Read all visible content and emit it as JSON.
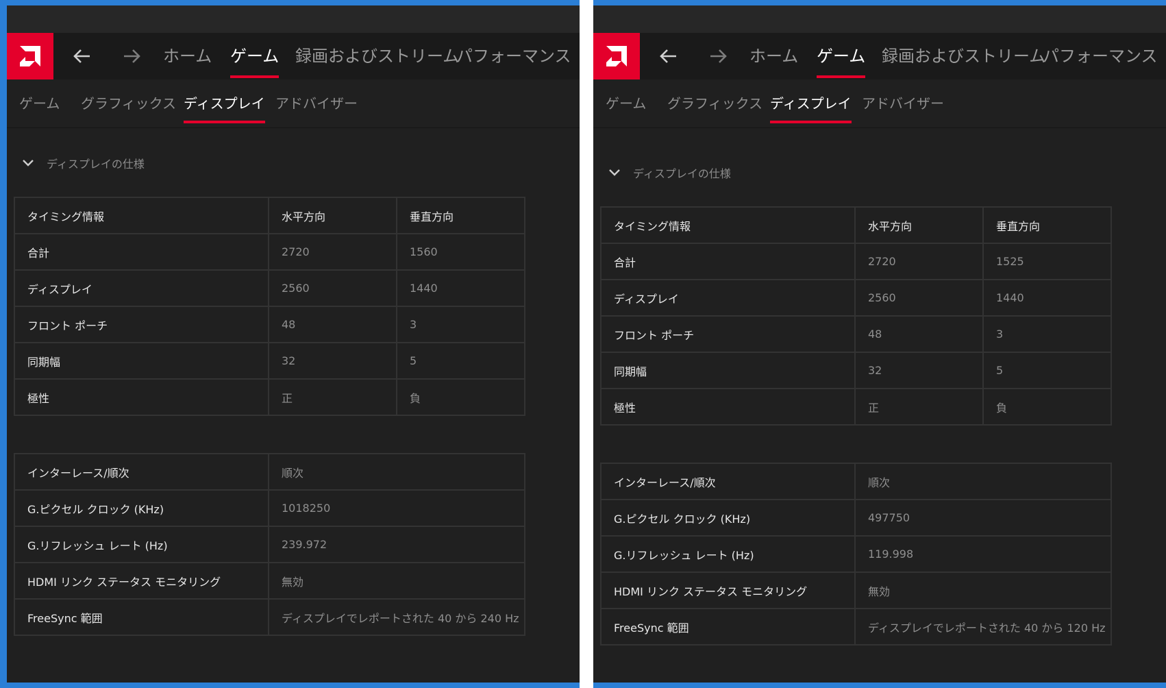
{
  "nav": {
    "home": "ホーム",
    "game": "ゲーム",
    "record": "録画およびストリーム",
    "performance": "パフォーマンス"
  },
  "subnav": {
    "game": "ゲーム",
    "graphics": "グラフィックス",
    "display": "ディスプレイ",
    "advisor": "アドバイザー"
  },
  "section_title": "ディスプレイの仕様",
  "columns": {
    "timing": "タイミング情報",
    "horizontal": "水平方向",
    "vertical": "垂直方向"
  },
  "labels": {
    "total": "合計",
    "display": "ディスプレイ",
    "front_porch": "フロント ポーチ",
    "sync_width": "同期幅",
    "polarity": "極性",
    "interlace": "インターレース/順次",
    "pixel_clock": "G.ピクセル クロック (KHz)",
    "refresh_rate": "G.リフレッシュ レート (Hz)",
    "hdmi_monitoring": "HDMI リンク ステータス モニタリング",
    "freesync": "FreeSync 範囲"
  },
  "left": {
    "total_h": "2720",
    "total_v": "1560",
    "display_h": "2560",
    "display_v": "1440",
    "porch_h": "48",
    "porch_v": "3",
    "sync_h": "32",
    "sync_v": "5",
    "polarity_h": "正",
    "polarity_v": "負",
    "interlace": "順次",
    "pixel_clock": "1018250",
    "refresh_rate": "239.972",
    "hdmi": "無効",
    "freesync": "ディスプレイでレポートされた 40 から 240 Hz"
  },
  "right": {
    "total_h": "2720",
    "total_v": "1525",
    "display_h": "2560",
    "display_v": "1440",
    "porch_h": "48",
    "porch_v": "3",
    "sync_h": "32",
    "sync_v": "5",
    "polarity_h": "正",
    "polarity_v": "負",
    "interlace": "順次",
    "pixel_clock": "497750",
    "refresh_rate": "119.998",
    "hdmi": "無効",
    "freesync": "ディスプレイでレポートされた 40 から 120 Hz"
  },
  "colors": {
    "accent": "#e4002b",
    "background": "#202020",
    "desktop": "#2b7fd6"
  },
  "icons": [
    "amd-logo-icon",
    "back-arrow-icon",
    "forward-arrow-icon",
    "chevron-down-icon"
  ]
}
